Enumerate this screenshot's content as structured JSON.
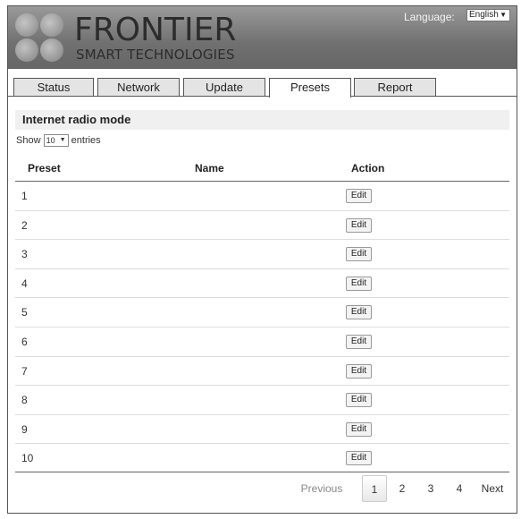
{
  "brand": {
    "main": "FRONTIER",
    "sub": "SMART TECHNOLOGIES"
  },
  "language": {
    "label": "Language:",
    "selected": "English"
  },
  "tabs": [
    {
      "label": "Status"
    },
    {
      "label": "Network"
    },
    {
      "label": "Update"
    },
    {
      "label": "Presets",
      "active": true
    },
    {
      "label": "Report"
    }
  ],
  "section": {
    "title": "Internet radio mode"
  },
  "length_menu": {
    "prefix": "Show",
    "selected": "10",
    "suffix": "entries"
  },
  "table": {
    "headers": {
      "preset": "Preset",
      "name": "Name",
      "action": "Action"
    },
    "rows": [
      {
        "preset": "1",
        "name": "",
        "action": "Edit"
      },
      {
        "preset": "2",
        "name": "",
        "action": "Edit"
      },
      {
        "preset": "3",
        "name": "",
        "action": "Edit"
      },
      {
        "preset": "4",
        "name": "",
        "action": "Edit"
      },
      {
        "preset": "5",
        "name": "",
        "action": "Edit"
      },
      {
        "preset": "6",
        "name": "",
        "action": "Edit"
      },
      {
        "preset": "7",
        "name": "",
        "action": "Edit"
      },
      {
        "preset": "8",
        "name": "",
        "action": "Edit"
      },
      {
        "preset": "9",
        "name": "",
        "action": "Edit"
      },
      {
        "preset": "10",
        "name": "",
        "action": "Edit"
      }
    ]
  },
  "pagination": {
    "previous": "Previous",
    "pages": [
      "1",
      "2",
      "3",
      "4"
    ],
    "current": "1",
    "next": "Next"
  },
  "colors": {
    "header_dark": "#666666",
    "tab_inactive": "#e4e4e4",
    "section_bg": "#f0f0f0"
  }
}
